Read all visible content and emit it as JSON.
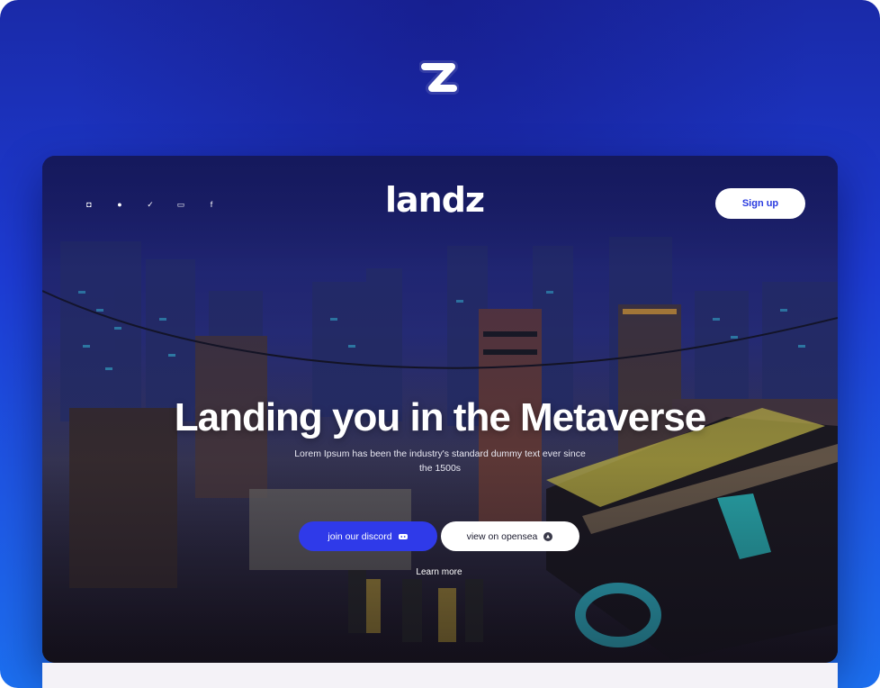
{
  "brand": {
    "mark_icon": "landz-z-mark-icon",
    "logo_text": "landz"
  },
  "nav": {
    "socials": [
      {
        "icon": "discord-icon",
        "glyph": "◘"
      },
      {
        "icon": "opensea-icon",
        "glyph": "●"
      },
      {
        "icon": "twitter-icon",
        "glyph": "✓"
      },
      {
        "icon": "youtube-icon",
        "glyph": "▭"
      },
      {
        "icon": "facebook-icon",
        "glyph": "f"
      }
    ],
    "signup_label": "Sign up"
  },
  "hero": {
    "title": "Landing you in the Metaverse",
    "subtitle": "Lorem Ipsum has been the industry's standard dummy text ever since the 1500s",
    "discord_button": "join our discord",
    "opensea_button": "view on opensea",
    "learn_more": "Learn more"
  },
  "colors": {
    "background_top": "#1a2aa8",
    "background_bottom": "#1c6ff0",
    "primary_button": "#2f3ae9",
    "signup_text": "#2a3be0"
  }
}
